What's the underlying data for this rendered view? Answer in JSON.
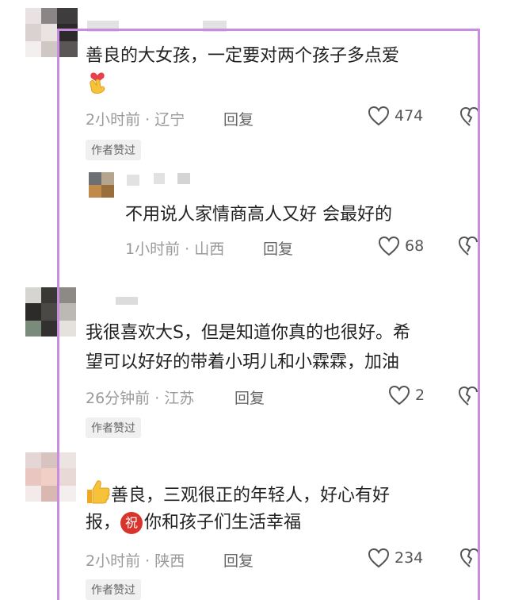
{
  "comments": [
    {
      "text_lines": [
        "善良的大女孩，一定要对两个孩子多点爱"
      ],
      "emoji": "heart-hands",
      "time": "2小时前",
      "location": "辽宁",
      "reply_label": "回复",
      "likes": "474",
      "badge": "作者赞过",
      "reply": {
        "text": "不用说人家情商高人又好 会最好的",
        "time": "1小时前",
        "location": "山西",
        "reply_label": "回复",
        "likes": "68"
      }
    },
    {
      "text_lines": [
        "我很喜欢大S，但是知道你真的也很好。希",
        "望可以好好的带着小玥儿和小霖霖，加油"
      ],
      "time": "26分钟前",
      "location": "江苏",
      "reply_label": "回复",
      "likes": "2",
      "badge": "作者赞过"
    },
    {
      "text_line1": "善良，三观很正的年轻人，好心有好",
      "text_line2_prefix": "报，",
      "text_line2_suffix": "你和孩子们生活幸福",
      "emoji_thumb": "thumbs-up",
      "emoji_zhu": "祝",
      "time": "2小时前",
      "location": "陕西",
      "reply_label": "回复",
      "likes": "234",
      "badge": "作者赞过"
    }
  ],
  "separator": " · ",
  "colors": {
    "frame": "#c98ddf",
    "meta": "#9a9a9a",
    "badge_bg": "#f0f0f0"
  }
}
